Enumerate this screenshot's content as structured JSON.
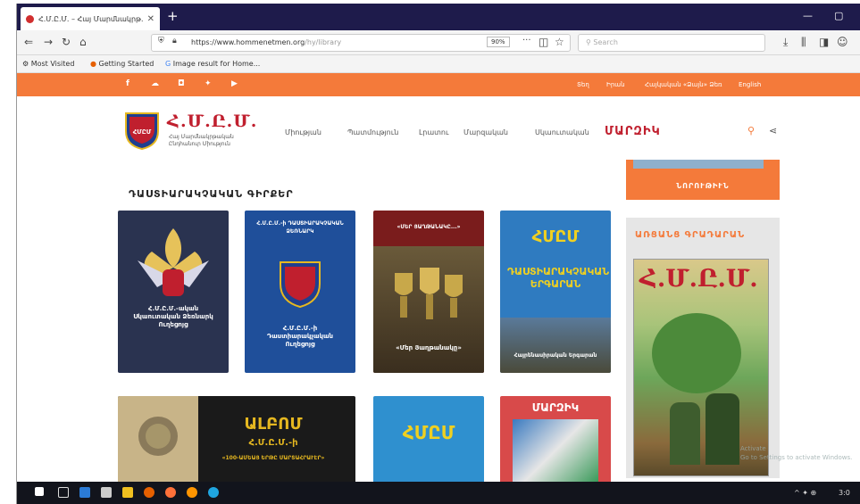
{
  "browser": {
    "tab_title": "Հ.Մ.Ը.Մ. – Հայ Մարմնակրթ…",
    "tab_close": "✕",
    "new_tab": "+",
    "url_host": "https://www.hommenetmen.org",
    "url_path": "/hy/library",
    "zoom": "90%",
    "search_placeholder": "Search",
    "bookmarks": [
      "Most Visited",
      "Getting Started",
      "Image result for Home..."
    ]
  },
  "site": {
    "brand": "Հ.Մ.Ը.Մ.",
    "brand_sub": "Հայ Մարմնակրթական Ընդհանուր Միություն",
    "lang_links": [
      "Տեղ",
      "Իրան",
      "Հայկական «Ձայն» Ձեռ",
      "English"
    ],
    "menu": [
      "Միության",
      "Պատմություն",
      "Լրատու",
      "Մարզական",
      "Սկաուտական"
    ],
    "menu_bold": "ՄԱՐԶԻԿ",
    "section_title": "ԴԱՍՏԻԱՐԱԿՉԱԿԱՆ ԳԻՐՔԵՐ",
    "sidebar": {
      "news_button": "ՆՈՐՈՒԹԻՒՆ",
      "archive_title": "ԱՌՑԱՆՑ ԳՐԱԴԱՐԱՆ",
      "magazine_title": "Հ.Մ.Ը.Մ."
    },
    "books_row1": [
      {
        "caption": "Հ.Մ.Ը.Մ.-ական Սկաուտական Ձեռնարկ Ուղեցոյց",
        "bg": "#2a3350"
      },
      {
        "top": "Հ.Մ.Ը.Մ.-ի ԴԱՍՏԻԱՐԱԿՉԱԿԱՆ ՁԵՌՆԱՐԿ",
        "caption": "Հ.Մ.Ը.Մ.-ի Դաստիարակչական Ուղեցոյց",
        "bg": "#1f4f9a"
      },
      {
        "top": "«ՄԵՐ ՅԱՂԹԱՆԱԿԸ...»",
        "caption": "«Մեր Յաղթանակը»",
        "bg": "#7a1c1c"
      },
      {
        "logo": "ՀՄԸՄ",
        "mid": "ԴԱՍՏԻԱՐԱԿՉԱԿԱՆ ԵՐԳԱՐԱՆ",
        "caption": "Հայրենասիրական Երգարան",
        "bg": "#2f7bc0"
      }
    ],
    "books_row2": [
      {
        "title": "ԱԼԲՈՄ",
        "sub": "Հ.Մ.Ը.Մ.-ի",
        "caption": "«100-ԱՄԵԱՅ ԵՐԹԸ ՄԱՐՏԱՀՐԱՒԷՐ»",
        "bg": "#1a1a1a"
      },
      {
        "logo": "ՀՄԸՄ",
        "bg": "#2f90cf"
      },
      {
        "title": "ՄԱՐԶԻԿ",
        "bg": "#d84a4a"
      }
    ]
  },
  "taskbar": {
    "tray_text": "^ ✦ ⊕",
    "clock": "3:0",
    "watermark_line1": "Activate",
    "watermark_line2": "Go to Settings to activate Windows."
  }
}
